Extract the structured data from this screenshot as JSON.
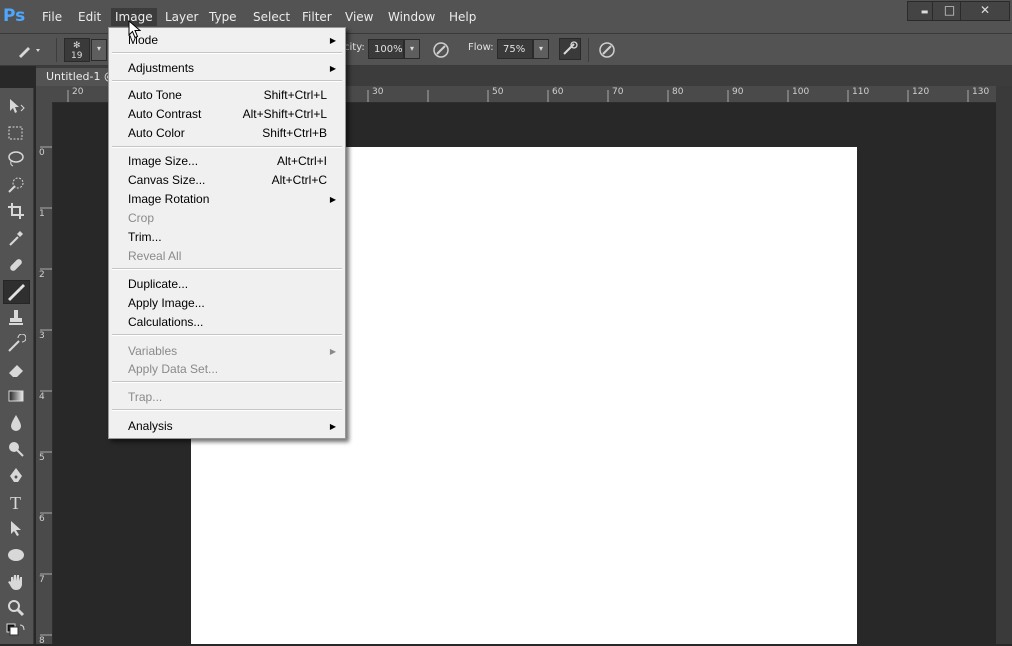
{
  "app": {
    "logo": "Ps"
  },
  "menubar": {
    "items": [
      "File",
      "Edit",
      "Image",
      "Layer",
      "Type",
      "Select",
      "Filter",
      "View",
      "Window",
      "Help"
    ],
    "active": "Image"
  },
  "window_controls": {
    "minimize": "▬",
    "restore": "□",
    "close": "✕"
  },
  "options_bar": {
    "brush_size": "19",
    "opacity_label": "city:",
    "opacity_value": "100%",
    "flow_label": "Flow:",
    "flow_value": "75%"
  },
  "document_tab": {
    "title": "Untitled-1 @"
  },
  "ruler": {
    "horizontal": [
      "20",
      "30",
      "50",
      "60",
      "70",
      "80",
      "90",
      "100",
      "110",
      "120",
      "130"
    ],
    "vertical": [
      "0",
      "1",
      "2",
      "3",
      "4",
      "5",
      "6",
      "7",
      "8"
    ]
  },
  "image_menu": {
    "groups": [
      [
        {
          "label": "Mode",
          "submenu": true,
          "enabled": true
        }
      ],
      [
        {
          "label": "Adjustments",
          "submenu": true,
          "enabled": true
        }
      ],
      [
        {
          "label": "Auto Tone",
          "shortcut": "Shift+Ctrl+L",
          "enabled": true
        },
        {
          "label": "Auto Contrast",
          "shortcut": "Alt+Shift+Ctrl+L",
          "enabled": true
        },
        {
          "label": "Auto Color",
          "shortcut": "Shift+Ctrl+B",
          "enabled": true
        }
      ],
      [
        {
          "label": "Image Size...",
          "shortcut": "Alt+Ctrl+I",
          "enabled": true
        },
        {
          "label": "Canvas Size...",
          "shortcut": "Alt+Ctrl+C",
          "enabled": true
        },
        {
          "label": "Image Rotation",
          "submenu": true,
          "enabled": true
        },
        {
          "label": "Crop",
          "enabled": false
        },
        {
          "label": "Trim...",
          "enabled": true
        },
        {
          "label": "Reveal All",
          "enabled": false
        }
      ],
      [
        {
          "label": "Duplicate...",
          "enabled": true
        },
        {
          "label": "Apply Image...",
          "enabled": true
        },
        {
          "label": "Calculations...",
          "enabled": true
        }
      ],
      [
        {
          "label": "Variables",
          "submenu": true,
          "enabled": false
        },
        {
          "label": "Apply Data Set...",
          "enabled": false
        }
      ],
      [
        {
          "label": "Trap...",
          "enabled": false
        }
      ],
      [
        {
          "label": "Analysis",
          "submenu": true,
          "enabled": true
        }
      ]
    ]
  },
  "colors": {
    "menu_bg": "#f0f0f0",
    "chrome": "#535353",
    "workspace": "#282828",
    "canvas": "#ffffff",
    "logo": "#4ea6ff"
  }
}
